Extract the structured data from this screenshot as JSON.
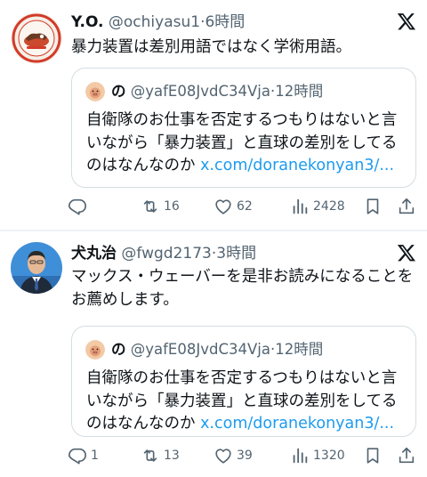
{
  "tweets": [
    {
      "author": {
        "name": "Y.O.",
        "handle": "@ochiyasu1",
        "time": "6時間"
      },
      "text": "暴力装置は差別用語ではなく学術用語。",
      "quote": {
        "name": "の",
        "handle": "@yafE08JvdC34Vja",
        "time": "12時間",
        "text": "自衛隊のお仕事を否定するつもりはないと言いながら「暴力装置」と直球の差別をしてるのはなんなのか",
        "link": "x.com/doranekonyan3/..."
      },
      "stats": {
        "replies": "",
        "reposts": "16",
        "likes": "62",
        "views": "2428"
      }
    },
    {
      "author": {
        "name": "犬丸治",
        "handle": "@fwgd2173",
        "time": "3時間"
      },
      "text": "マックス・ウェーバーを是非お読みになることをお薦めします。",
      "quote": {
        "name": "の",
        "handle": "@yafE08JvdC34Vja",
        "time": "12時間",
        "text": "自衛隊のお仕事を否定するつもりはないと言いながら「暴力装置」と直球の差別をしてるのはなんなのか",
        "link": "x.com/doranekonyan3/..."
      },
      "stats": {
        "replies": "1",
        "reposts": "13",
        "likes": "39",
        "views": "1320"
      }
    }
  ],
  "separator": "·",
  "colors": {
    "text": "#0f1419",
    "muted": "#536471",
    "link": "#1d9bf0",
    "border": "#d5dde2"
  },
  "icons": [
    "x-logo-icon",
    "reply-icon",
    "repost-icon",
    "like-icon",
    "views-icon",
    "bookmark-icon",
    "share-icon"
  ]
}
